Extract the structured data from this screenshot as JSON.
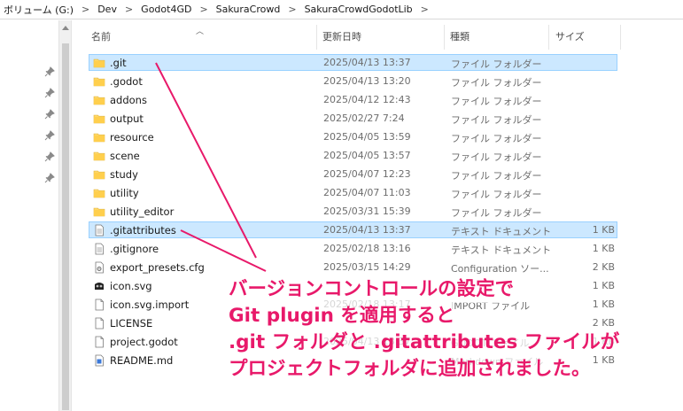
{
  "breadcrumb": [
    "ボリューム (G:)",
    "Dev",
    "Godot4GD",
    "SakuraCrowd",
    "SakuraCrowdGodotLib"
  ],
  "breadcrumb_separator": ">",
  "columns": {
    "name": "名前",
    "date": "更新日時",
    "type": "種類",
    "size": "サイズ"
  },
  "files": [
    {
      "name": ".git",
      "date": "2025/04/13 13:37",
      "type": "ファイル フォルダー",
      "size": "",
      "icon": "folder-icon",
      "selected": true
    },
    {
      "name": ".godot",
      "date": "2025/04/13 13:20",
      "type": "ファイル フォルダー",
      "size": "",
      "icon": "folder-icon",
      "selected": false
    },
    {
      "name": "addons",
      "date": "2025/04/12 12:43",
      "type": "ファイル フォルダー",
      "size": "",
      "icon": "folder-icon",
      "selected": false
    },
    {
      "name": "output",
      "date": "2025/02/27 7:24",
      "type": "ファイル フォルダー",
      "size": "",
      "icon": "folder-icon",
      "selected": false
    },
    {
      "name": "resource",
      "date": "2025/04/05 13:59",
      "type": "ファイル フォルダー",
      "size": "",
      "icon": "folder-icon",
      "selected": false
    },
    {
      "name": "scene",
      "date": "2025/04/05 13:57",
      "type": "ファイル フォルダー",
      "size": "",
      "icon": "folder-icon",
      "selected": false
    },
    {
      "name": "study",
      "date": "2025/04/07 12:23",
      "type": "ファイル フォルダー",
      "size": "",
      "icon": "folder-icon",
      "selected": false
    },
    {
      "name": "utility",
      "date": "2025/04/07 11:03",
      "type": "ファイル フォルダー",
      "size": "",
      "icon": "folder-icon",
      "selected": false
    },
    {
      "name": "utility_editor",
      "date": "2025/03/31 15:39",
      "type": "ファイル フォルダー",
      "size": "",
      "icon": "folder-icon",
      "selected": false
    },
    {
      "name": ".gitattributes",
      "date": "2025/04/13 13:37",
      "type": "テキスト ドキュメント",
      "size": "1 KB",
      "icon": "text-file-icon",
      "selected": true
    },
    {
      "name": ".gitignore",
      "date": "2025/02/18 13:16",
      "type": "テキスト ドキュメント",
      "size": "1 KB",
      "icon": "text-file-icon",
      "selected": false
    },
    {
      "name": "export_presets.cfg",
      "date": "2025/03/15 14:29",
      "type": "Configuration ソー...",
      "size": "2 KB",
      "icon": "config-file-icon",
      "selected": false
    },
    {
      "name": "icon.svg",
      "date": "",
      "type": "",
      "size": "1 KB",
      "icon": "godot-svg-icon",
      "selected": false
    },
    {
      "name": "icon.svg.import",
      "date": "2025/02/18 13:17",
      "type": "IMPORT ファイル",
      "size": "1 KB",
      "icon": "file-icon",
      "selected": false
    },
    {
      "name": "LICENSE",
      "date": "",
      "type": "",
      "size": "2 KB",
      "icon": "file-icon",
      "selected": false
    },
    {
      "name": "project.godot",
      "date": "2025/04/13 13:37",
      "type": "GODOT ファイル",
      "size": "1 KB",
      "icon": "file-icon",
      "selected": false
    },
    {
      "name": "README.md",
      "date": "",
      "type": "Markdown ファイル",
      "size": "1 KB",
      "icon": "markdown-file-icon",
      "selected": false
    }
  ],
  "annotation": {
    "lines": [
      "バージョンコントロールの設定で",
      "Git plugin を適用すると",
      ".git フォルダと .gitattributes ファイルが",
      "プロジェクトフォルダに追加されました。"
    ],
    "color": "#e8196a"
  },
  "colors": {
    "selection_bg": "#cce8ff",
    "selection_border": "#99d1ff",
    "folder": "#ffd767"
  }
}
